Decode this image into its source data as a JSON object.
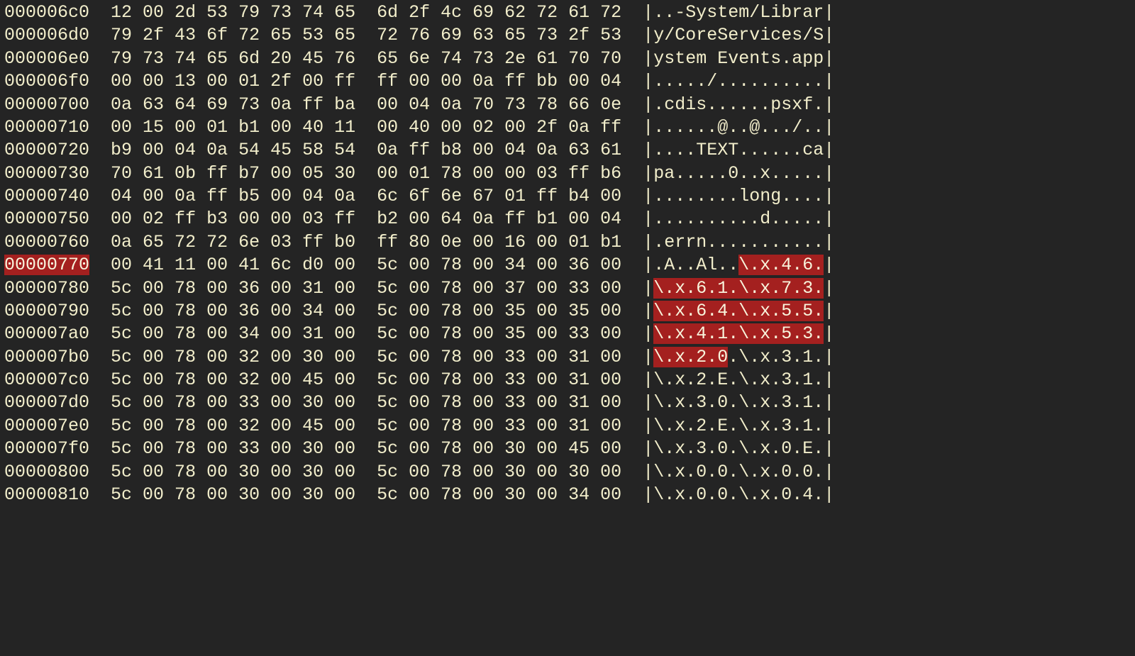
{
  "colors": {
    "bg": "#242424",
    "fg": "#f2eecb",
    "highlight_bg": "#a4201f",
    "highlight_fg": "#f8f4dc"
  },
  "hex_dump": {
    "rows": [
      {
        "address": "000006c0",
        "hex1": "12 00 2d 53 79 73 74 65",
        "hex2": "6d 2f 4c 69 62 72 61 72",
        "ascii_runs": [
          {
            "text": "..-System/Librar",
            "highlight": false
          }
        ],
        "address_highlight": false
      },
      {
        "address": "000006d0",
        "hex1": "79 2f 43 6f 72 65 53 65",
        "hex2": "72 76 69 63 65 73 2f 53",
        "ascii_runs": [
          {
            "text": "y/CoreServices/S",
            "highlight": false
          }
        ],
        "address_highlight": false
      },
      {
        "address": "000006e0",
        "hex1": "79 73 74 65 6d 20 45 76",
        "hex2": "65 6e 74 73 2e 61 70 70",
        "ascii_runs": [
          {
            "text": "ystem Events.app",
            "highlight": false
          }
        ],
        "address_highlight": false
      },
      {
        "address": "000006f0",
        "hex1": "00 00 13 00 01 2f 00 ff",
        "hex2": "ff 00 00 0a ff bb 00 04",
        "ascii_runs": [
          {
            "text": "...../..........",
            "highlight": false
          }
        ],
        "address_highlight": false
      },
      {
        "address": "00000700",
        "hex1": "0a 63 64 69 73 0a ff ba",
        "hex2": "00 04 0a 70 73 78 66 0e",
        "ascii_runs": [
          {
            "text": ".cdis......psxf.",
            "highlight": false
          }
        ],
        "address_highlight": false
      },
      {
        "address": "00000710",
        "hex1": "00 15 00 01 b1 00 40 11",
        "hex2": "00 40 00 02 00 2f 0a ff",
        "ascii_runs": [
          {
            "text": "......@..@.../..",
            "highlight": false
          }
        ],
        "address_highlight": false
      },
      {
        "address": "00000720",
        "hex1": "b9 00 04 0a 54 45 58 54",
        "hex2": "0a ff b8 00 04 0a 63 61",
        "ascii_runs": [
          {
            "text": "....TEXT......ca",
            "highlight": false
          }
        ],
        "address_highlight": false
      },
      {
        "address": "00000730",
        "hex1": "70 61 0b ff b7 00 05 30",
        "hex2": "00 01 78 00 00 03 ff b6",
        "ascii_runs": [
          {
            "text": "pa.....0..x.....",
            "highlight": false
          }
        ],
        "address_highlight": false
      },
      {
        "address": "00000740",
        "hex1": "04 00 0a ff b5 00 04 0a",
        "hex2": "6c 6f 6e 67 01 ff b4 00",
        "ascii_runs": [
          {
            "text": "........long....",
            "highlight": false
          }
        ],
        "address_highlight": false
      },
      {
        "address": "00000750",
        "hex1": "00 02 ff b3 00 00 03 ff",
        "hex2": "b2 00 64 0a ff b1 00 04",
        "ascii_runs": [
          {
            "text": "..........d.....",
            "highlight": false
          }
        ],
        "address_highlight": false
      },
      {
        "address": "00000760",
        "hex1": "0a 65 72 72 6e 03 ff b0",
        "hex2": "ff 80 0e 00 16 00 01 b1",
        "ascii_runs": [
          {
            "text": ".errn...........",
            "highlight": false
          }
        ],
        "address_highlight": false
      },
      {
        "address": "00000770",
        "hex1": "00 41 11 00 41 6c d0 00",
        "hex2": "5c 00 78 00 34 00 36 00",
        "ascii_runs": [
          {
            "text": ".A..Al..",
            "highlight": false
          },
          {
            "text": "\\.x.4.6.",
            "highlight": true
          }
        ],
        "address_highlight": true
      },
      {
        "address": "00000780",
        "hex1": "5c 00 78 00 36 00 31 00",
        "hex2": "5c 00 78 00 37 00 33 00",
        "ascii_runs": [
          {
            "text": "\\.x.6.1.\\.x.7.3.",
            "highlight": true
          }
        ],
        "address_highlight": false
      },
      {
        "address": "00000790",
        "hex1": "5c 00 78 00 36 00 34 00",
        "hex2": "5c 00 78 00 35 00 35 00",
        "ascii_runs": [
          {
            "text": "\\.x.6.4.\\.x.5.5.",
            "highlight": true
          }
        ],
        "address_highlight": false
      },
      {
        "address": "000007a0",
        "hex1": "5c 00 78 00 34 00 31 00",
        "hex2": "5c 00 78 00 35 00 33 00",
        "ascii_runs": [
          {
            "text": "\\.x.4.1.\\.x.5.3.",
            "highlight": true
          }
        ],
        "address_highlight": false
      },
      {
        "address": "000007b0",
        "hex1": "5c 00 78 00 32 00 30 00",
        "hex2": "5c 00 78 00 33 00 31 00",
        "ascii_runs": [
          {
            "text": "\\.x.2.0",
            "highlight": true
          },
          {
            "text": ".\\.x.3.1.",
            "highlight": false
          }
        ],
        "address_highlight": false
      },
      {
        "address": "000007c0",
        "hex1": "5c 00 78 00 32 00 45 00",
        "hex2": "5c 00 78 00 33 00 31 00",
        "ascii_runs": [
          {
            "text": "\\.x.2.E.\\.x.3.1.",
            "highlight": false
          }
        ],
        "address_highlight": false
      },
      {
        "address": "000007d0",
        "hex1": "5c 00 78 00 33 00 30 00",
        "hex2": "5c 00 78 00 33 00 31 00",
        "ascii_runs": [
          {
            "text": "\\.x.3.0.\\.x.3.1.",
            "highlight": false
          }
        ],
        "address_highlight": false
      },
      {
        "address": "000007e0",
        "hex1": "5c 00 78 00 32 00 45 00",
        "hex2": "5c 00 78 00 33 00 31 00",
        "ascii_runs": [
          {
            "text": "\\.x.2.E.\\.x.3.1.",
            "highlight": false
          }
        ],
        "address_highlight": false
      },
      {
        "address": "000007f0",
        "hex1": "5c 00 78 00 33 00 30 00",
        "hex2": "5c 00 78 00 30 00 45 00",
        "ascii_runs": [
          {
            "text": "\\.x.3.0.\\.x.0.E.",
            "highlight": false
          }
        ],
        "address_highlight": false
      },
      {
        "address": "00000800",
        "hex1": "5c 00 78 00 30 00 30 00",
        "hex2": "5c 00 78 00 30 00 30 00",
        "ascii_runs": [
          {
            "text": "\\.x.0.0.\\.x.0.0.",
            "highlight": false
          }
        ],
        "address_highlight": false
      },
      {
        "address": "00000810",
        "hex1": "5c 00 78 00 30 00 30 00",
        "hex2": "5c 00 78 00 30 00 34 00",
        "ascii_runs": [
          {
            "text": "\\.x.0.0.\\.x.0.4.",
            "highlight": false
          }
        ],
        "address_highlight": false
      }
    ]
  }
}
